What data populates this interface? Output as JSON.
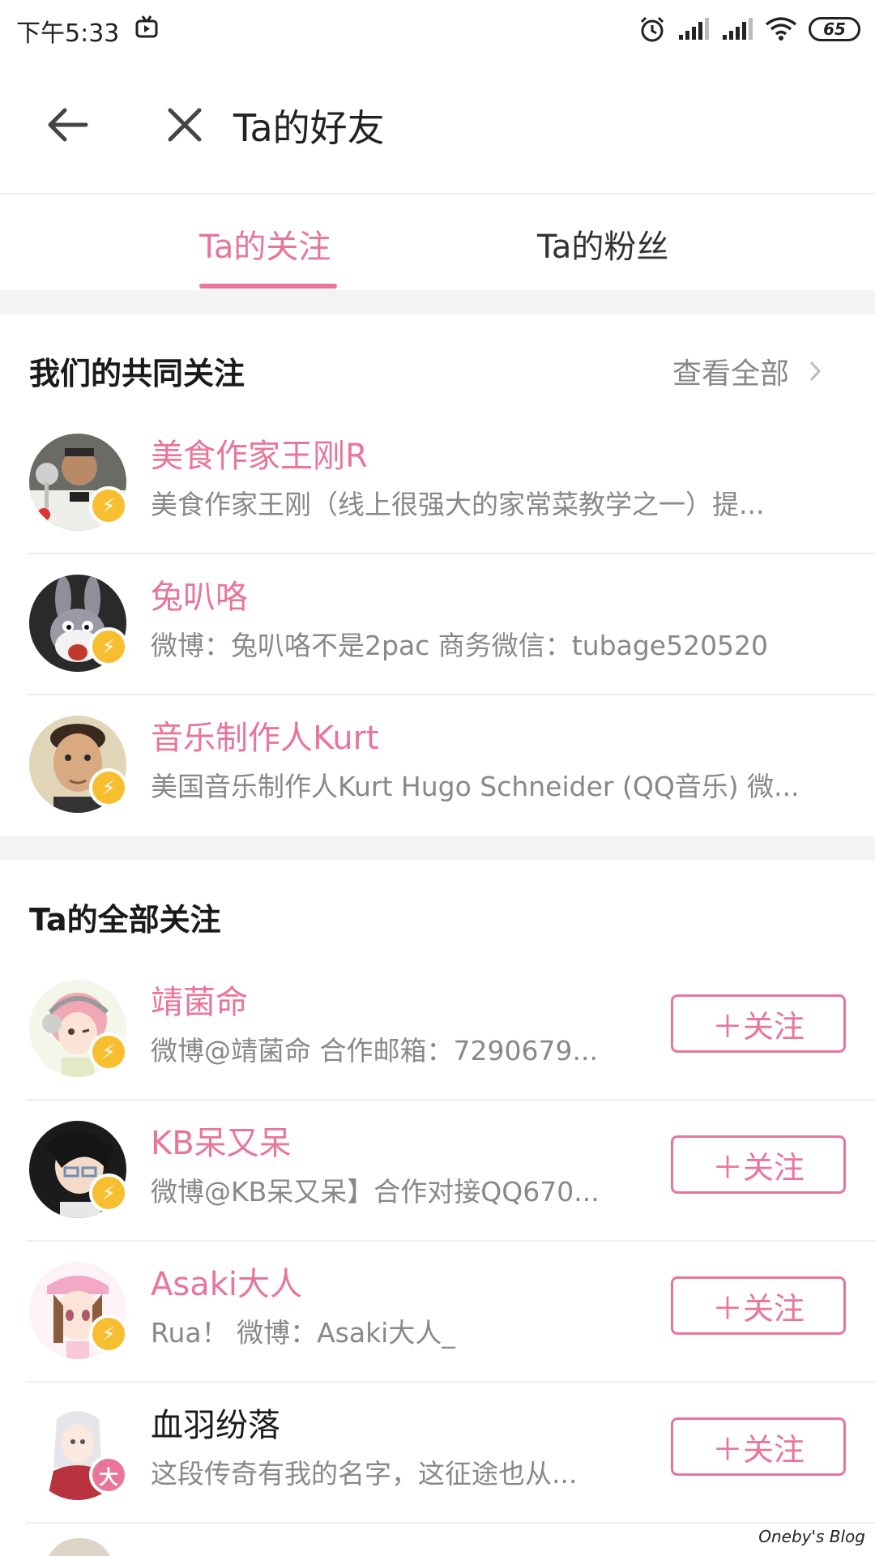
{
  "status_bar": {
    "time": "下午5:33",
    "battery": "65"
  },
  "header": {
    "title": "Ta的好友"
  },
  "tabs": [
    {
      "label": "Ta的关注",
      "active": true
    },
    {
      "label": "Ta的粉丝",
      "active": false
    }
  ],
  "common_section": {
    "title": "我们的共同关注",
    "view_all": "查看全部",
    "items": [
      {
        "name": "美食作家王刚R",
        "desc": "美食作家王刚（线上很强大的家常菜教学之一）提..."
      },
      {
        "name": "兔叭咯",
        "desc": "微博：兔叭咯不是2pac 商务微信：tubage520520"
      },
      {
        "name": "音乐制作人Kurt",
        "desc": "美国音乐制作人Kurt Hugo Schneider (QQ音乐) 微..."
      }
    ]
  },
  "all_section": {
    "title": "Ta的全部关注",
    "follow_label": "＋关注",
    "items": [
      {
        "name": "靖菌命",
        "desc": "微博@靖菌命 合作邮箱：7290679..."
      },
      {
        "name": "KB呆又呆",
        "desc": "微博@KB呆又呆】合作对接QQ670..."
      },
      {
        "name": "Asaki大人",
        "desc": "Rua！ 微博：Asaki大人_"
      },
      {
        "name": "血羽纷落",
        "desc": "这段传奇有我的名字，这征途也从...",
        "badge": "大"
      }
    ]
  },
  "watermark": "Oneby's Blog",
  "colors": {
    "accent": "#e8759a",
    "badge_yellow": "#f7be2f",
    "gray_text": "#888888"
  }
}
